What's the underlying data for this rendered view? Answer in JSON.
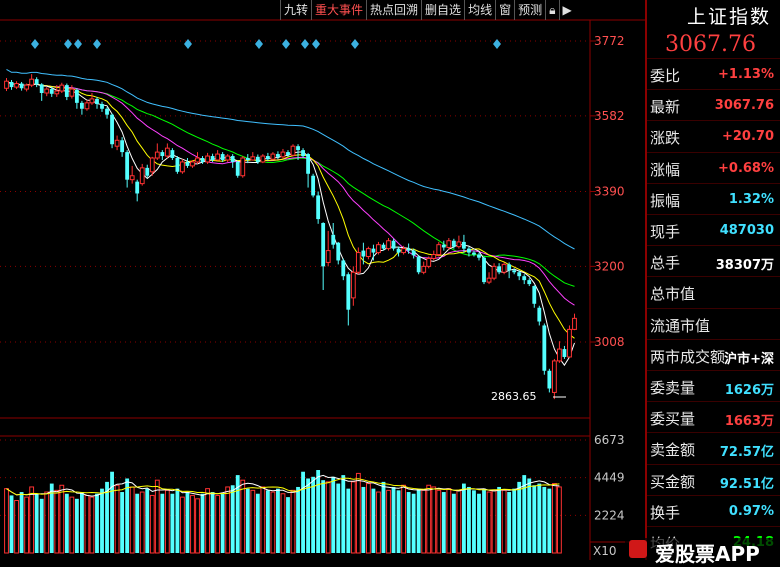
{
  "toolbar": {
    "items": [
      "九转",
      "重大事件",
      "热点回溯",
      "删自选",
      "均线",
      "窗",
      "预测"
    ]
  },
  "panel": {
    "title": "上证指数",
    "price": "3067.76",
    "rows": [
      {
        "label": "委比",
        "value": "+1.13%",
        "color": "red"
      },
      {
        "label": "最新",
        "value": "3067.76",
        "color": "red"
      },
      {
        "label": "涨跌",
        "value": "+20.70",
        "color": "red"
      },
      {
        "label": "涨幅",
        "value": "+0.68%",
        "color": "red"
      },
      {
        "label": "振幅",
        "value": "1.32%",
        "color": "cyan"
      },
      {
        "label": "现手",
        "value": "487030",
        "color": "cyan"
      },
      {
        "label": "总手",
        "value": "38307万",
        "color": "white"
      },
      {
        "label": "总市值",
        "value": "",
        "color": "white"
      },
      {
        "label": "流通市值",
        "value": "",
        "color": "white"
      },
      {
        "label": "两市成交额",
        "value": "沪市+深",
        "color": "white"
      },
      {
        "label": "委卖量",
        "value": "1626万",
        "color": "cyan"
      },
      {
        "label": "委买量",
        "value": "1663万",
        "color": "red"
      },
      {
        "label": "卖金额",
        "value": "72.57亿",
        "color": "cyan"
      },
      {
        "label": "买金额",
        "value": "92.51亿",
        "color": "cyan"
      },
      {
        "label": "换手",
        "value": "0.97%",
        "color": "cyan"
      },
      {
        "label": "均价",
        "value": "24.18",
        "color": "green"
      }
    ]
  },
  "watermark": {
    "text": "爱股票APP"
  },
  "x10_label": "X10",
  "chart_data": {
    "type": "candlestick",
    "price_axis": {
      "min": 2780,
      "max": 3800,
      "ticks": [
        3772,
        3582,
        3390,
        3200,
        3008
      ]
    },
    "volume_axis": {
      "max": 7200,
      "ticks": [
        6673,
        4449,
        2224
      ]
    },
    "low_annotation": "2863.65",
    "colors": {
      "up": "#ff3232",
      "down": "#54ffff",
      "ma5": "#ffffff",
      "ma10": "#ffff00",
      "ma20": "#ff40ff",
      "ma30": "#00ff00",
      "ma60": "#40c0ff",
      "grid": "#8b0000"
    },
    "event_markers": [
      35,
      68,
      78,
      97,
      188,
      259,
      286,
      305,
      316,
      355,
      497
    ],
    "candles": [
      {
        "o": 3652,
        "c": 3670,
        "h": 3678,
        "l": 3645
      },
      {
        "o": 3668,
        "c": 3655,
        "h": 3673,
        "l": 3648
      },
      {
        "o": 3655,
        "c": 3664,
        "h": 3670,
        "l": 3650
      },
      {
        "o": 3664,
        "c": 3652,
        "h": 3668,
        "l": 3646
      },
      {
        "o": 3650,
        "c": 3660,
        "h": 3664,
        "l": 3644
      },
      {
        "o": 3660,
        "c": 3675,
        "h": 3688,
        "l": 3655
      },
      {
        "o": 3675,
        "c": 3662,
        "h": 3680,
        "l": 3655
      },
      {
        "o": 3662,
        "c": 3640,
        "h": 3665,
        "l": 3620
      },
      {
        "o": 3640,
        "c": 3650,
        "h": 3655,
        "l": 3632
      },
      {
        "o": 3650,
        "c": 3638,
        "h": 3656,
        "l": 3630
      },
      {
        "o": 3638,
        "c": 3645,
        "h": 3660,
        "l": 3630
      },
      {
        "o": 3645,
        "c": 3660,
        "h": 3666,
        "l": 3640
      },
      {
        "o": 3660,
        "c": 3630,
        "h": 3664,
        "l": 3622
      },
      {
        "o": 3632,
        "c": 3650,
        "h": 3660,
        "l": 3626
      },
      {
        "o": 3648,
        "c": 3615,
        "h": 3652,
        "l": 3600
      },
      {
        "o": 3615,
        "c": 3600,
        "h": 3620,
        "l": 3585
      },
      {
        "o": 3600,
        "c": 3615,
        "h": 3622,
        "l": 3595
      },
      {
        "o": 3615,
        "c": 3625,
        "h": 3640,
        "l": 3610
      },
      {
        "o": 3625,
        "c": 3612,
        "h": 3630,
        "l": 3600
      },
      {
        "o": 3612,
        "c": 3600,
        "h": 3618,
        "l": 3592
      },
      {
        "o": 3600,
        "c": 3585,
        "h": 3604,
        "l": 3575
      },
      {
        "o": 3585,
        "c": 3510,
        "h": 3588,
        "l": 3500
      },
      {
        "o": 3505,
        "c": 3520,
        "h": 3532,
        "l": 3495
      },
      {
        "o": 3520,
        "c": 3490,
        "h": 3528,
        "l": 3478
      },
      {
        "o": 3490,
        "c": 3420,
        "h": 3495,
        "l": 3400
      },
      {
        "o": 3420,
        "c": 3430,
        "h": 3455,
        "l": 3410
      },
      {
        "o": 3415,
        "c": 3385,
        "h": 3420,
        "l": 3365
      },
      {
        "o": 3410,
        "c": 3450,
        "h": 3460,
        "l": 3405
      },
      {
        "o": 3450,
        "c": 3430,
        "h": 3458,
        "l": 3425
      },
      {
        "o": 3440,
        "c": 3475,
        "h": 3478,
        "l": 3430
      },
      {
        "o": 3475,
        "c": 3490,
        "h": 3512,
        "l": 3470
      },
      {
        "o": 3490,
        "c": 3480,
        "h": 3495,
        "l": 3470
      },
      {
        "o": 3480,
        "c": 3500,
        "h": 3512,
        "l": 3475
      },
      {
        "o": 3495,
        "c": 3475,
        "h": 3500,
        "l": 3470
      },
      {
        "o": 3475,
        "c": 3440,
        "h": 3480,
        "l": 3435
      },
      {
        "o": 3440,
        "c": 3465,
        "h": 3472,
        "l": 3435
      },
      {
        "o": 3465,
        "c": 3455,
        "h": 3475,
        "l": 3450
      },
      {
        "o": 3455,
        "c": 3465,
        "h": 3470,
        "l": 3450
      },
      {
        "o": 3465,
        "c": 3475,
        "h": 3490,
        "l": 3460
      },
      {
        "o": 3475,
        "c": 3465,
        "h": 3480,
        "l": 3460
      },
      {
        "o": 3465,
        "c": 3480,
        "h": 3488,
        "l": 3460
      },
      {
        "o": 3480,
        "c": 3470,
        "h": 3486,
        "l": 3465
      },
      {
        "o": 3470,
        "c": 3485,
        "h": 3495,
        "l": 3468
      },
      {
        "o": 3485,
        "c": 3470,
        "h": 3490,
        "l": 3465
      },
      {
        "o": 3470,
        "c": 3480,
        "h": 3485,
        "l": 3465
      },
      {
        "o": 3480,
        "c": 3465,
        "h": 3485,
        "l": 3450
      },
      {
        "o": 3465,
        "c": 3430,
        "h": 3468,
        "l": 3425
      },
      {
        "o": 3430,
        "c": 3475,
        "h": 3480,
        "l": 3425
      },
      {
        "o": 3475,
        "c": 3470,
        "h": 3485,
        "l": 3462
      },
      {
        "o": 3470,
        "c": 3478,
        "h": 3490,
        "l": 3468
      },
      {
        "o": 3478,
        "c": 3465,
        "h": 3484,
        "l": 3460
      },
      {
        "o": 3465,
        "c": 3480,
        "h": 3485,
        "l": 3462
      },
      {
        "o": 3480,
        "c": 3472,
        "h": 3488,
        "l": 3468
      },
      {
        "o": 3472,
        "c": 3485,
        "h": 3490,
        "l": 3470
      },
      {
        "o": 3485,
        "c": 3478,
        "h": 3492,
        "l": 3472
      },
      {
        "o": 3478,
        "c": 3490,
        "h": 3498,
        "l": 3474
      },
      {
        "o": 3490,
        "c": 3482,
        "h": 3495,
        "l": 3478
      },
      {
        "o": 3482,
        "c": 3505,
        "h": 3510,
        "l": 3480
      },
      {
        "o": 3505,
        "c": 3495,
        "h": 3510,
        "l": 3470
      },
      {
        "o": 3495,
        "c": 3480,
        "h": 3500,
        "l": 3475
      },
      {
        "o": 3485,
        "c": 3435,
        "h": 3488,
        "l": 3400
      },
      {
        "o": 3430,
        "c": 3380,
        "h": 3435,
        "l": 3375
      },
      {
        "o": 3380,
        "c": 3320,
        "h": 3390,
        "l": 3308
      },
      {
        "o": 3310,
        "c": 3200,
        "h": 3312,
        "l": 3140
      },
      {
        "o": 3210,
        "c": 3240,
        "h": 3290,
        "l": 3200
      },
      {
        "o": 3280,
        "c": 3255,
        "h": 3310,
        "l": 3245
      },
      {
        "o": 3260,
        "c": 3215,
        "h": 3262,
        "l": 3205
      },
      {
        "o": 3215,
        "c": 3175,
        "h": 3220,
        "l": 3165
      },
      {
        "o": 3180,
        "c": 3090,
        "h": 3185,
        "l": 3050
      },
      {
        "o": 3120,
        "c": 3185,
        "h": 3200,
        "l": 3100
      },
      {
        "o": 3185,
        "c": 3235,
        "h": 3248,
        "l": 3180
      },
      {
        "o": 3240,
        "c": 3225,
        "h": 3260,
        "l": 3205
      },
      {
        "o": 3225,
        "c": 3245,
        "h": 3250,
        "l": 3218
      },
      {
        "o": 3245,
        "c": 3235,
        "h": 3255,
        "l": 3215
      },
      {
        "o": 3235,
        "c": 3255,
        "h": 3262,
        "l": 3230
      },
      {
        "o": 3255,
        "c": 3245,
        "h": 3260,
        "l": 3240
      },
      {
        "o": 3245,
        "c": 3265,
        "h": 3272,
        "l": 3240
      },
      {
        "o": 3265,
        "c": 3245,
        "h": 3270,
        "l": 3240
      },
      {
        "o": 3245,
        "c": 3235,
        "h": 3250,
        "l": 3225
      },
      {
        "o": 3235,
        "c": 3245,
        "h": 3252,
        "l": 3230
      },
      {
        "o": 3245,
        "c": 3240,
        "h": 3258,
        "l": 3232
      },
      {
        "o": 3240,
        "c": 3228,
        "h": 3245,
        "l": 3220
      },
      {
        "o": 3225,
        "c": 3185,
        "h": 3228,
        "l": 3180
      },
      {
        "o": 3185,
        "c": 3200,
        "h": 3212,
        "l": 3180
      },
      {
        "o": 3200,
        "c": 3220,
        "h": 3225,
        "l": 3195
      },
      {
        "o": 3220,
        "c": 3230,
        "h": 3240,
        "l": 3215
      },
      {
        "o": 3230,
        "c": 3255,
        "h": 3262,
        "l": 3225
      },
      {
        "o": 3255,
        "c": 3248,
        "h": 3265,
        "l": 3240
      },
      {
        "o": 3248,
        "c": 3265,
        "h": 3272,
        "l": 3242
      },
      {
        "o": 3265,
        "c": 3250,
        "h": 3270,
        "l": 3245
      },
      {
        "o": 3250,
        "c": 3262,
        "h": 3278,
        "l": 3245
      },
      {
        "o": 3262,
        "c": 3245,
        "h": 3280,
        "l": 3235
      },
      {
        "o": 3245,
        "c": 3235,
        "h": 3250,
        "l": 3225
      },
      {
        "o": 3235,
        "c": 3230,
        "h": 3240,
        "l": 3225
      },
      {
        "o": 3230,
        "c": 3222,
        "h": 3235,
        "l": 3215
      },
      {
        "o": 3222,
        "c": 3160,
        "h": 3225,
        "l": 3155
      },
      {
        "o": 3160,
        "c": 3170,
        "h": 3185,
        "l": 3155
      },
      {
        "o": 3170,
        "c": 3200,
        "h": 3208,
        "l": 3165
      },
      {
        "o": 3200,
        "c": 3185,
        "h": 3208,
        "l": 3180
      },
      {
        "o": 3185,
        "c": 3205,
        "h": 3210,
        "l": 3180
      },
      {
        "o": 3205,
        "c": 3190,
        "h": 3210,
        "l": 3170
      },
      {
        "o": 3190,
        "c": 3185,
        "h": 3195,
        "l": 3180
      },
      {
        "o": 3185,
        "c": 3175,
        "h": 3190,
        "l": 3165
      },
      {
        "o": 3175,
        "c": 3165,
        "h": 3180,
        "l": 3155
      },
      {
        "o": 3165,
        "c": 3155,
        "h": 3170,
        "l": 3150
      },
      {
        "o": 3150,
        "c": 3105,
        "h": 3152,
        "l": 3095
      },
      {
        "o": 3095,
        "c": 3060,
        "h": 3100,
        "l": 3050
      },
      {
        "o": 3050,
        "c": 2935,
        "h": 3055,
        "l": 2925
      },
      {
        "o": 2935,
        "c": 2890,
        "h": 2940,
        "l": 2880
      },
      {
        "o": 2880,
        "c": 2960,
        "h": 2965,
        "l": 2863
      },
      {
        "o": 2960,
        "c": 2990,
        "h": 3010,
        "l": 2955
      },
      {
        "o": 2990,
        "c": 2970,
        "h": 2998,
        "l": 2965
      },
      {
        "o": 2970,
        "c": 3040,
        "h": 3050,
        "l": 2968
      },
      {
        "o": 3040,
        "c": 3068,
        "h": 3080,
        "l": 3038
      }
    ],
    "volume": [
      3800,
      3400,
      3100,
      3600,
      3300,
      3900,
      3500,
      3200,
      3600,
      4100,
      3700,
      4000,
      3500,
      3300,
      3200,
      3600,
      3400,
      3300,
      3500,
      3800,
      4200,
      4800,
      4000,
      3600,
      4400,
      3900,
      3500,
      3600,
      3800,
      3400,
      4300,
      3500,
      3700,
      3500,
      3800,
      3300,
      3600,
      3400,
      3200,
      3500,
      3800,
      3600,
      3400,
      3500,
      3900,
      4000,
      4600,
      4300,
      3800,
      3700,
      3500,
      3900,
      3700,
      3600,
      3800,
      3500,
      3300,
      3700,
      3900,
      4800,
      4400,
      4500,
      4900,
      4300,
      4200,
      4500,
      4100,
      4600,
      3800,
      4200,
      4700,
      3900,
      4100,
      3800,
      3600,
      4200,
      3700,
      3900,
      3700,
      4000,
      3600,
      3500,
      3800,
      3700,
      4000,
      3900,
      3700,
      3600,
      3800,
      3500,
      3700,
      4100,
      3900,
      3700,
      3500,
      3800,
      3600,
      3700,
      3900,
      3700,
      3600,
      3800,
      4200,
      4600,
      4400,
      4000,
      4100,
      3900,
      3800,
      4100,
      3900
    ]
  }
}
